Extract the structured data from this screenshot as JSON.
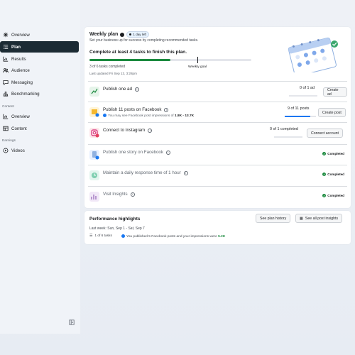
{
  "sidebar": {
    "items": [
      {
        "label": "Overview",
        "icon": "overview-icon"
      },
      {
        "label": "Plan",
        "icon": "plan-icon",
        "active": true
      },
      {
        "label": "Results",
        "icon": "results-icon"
      },
      {
        "label": "Audience",
        "icon": "audience-icon"
      },
      {
        "label": "Messaging",
        "icon": "messaging-icon"
      },
      {
        "label": "Benchmarking",
        "icon": "benchmarking-icon"
      }
    ],
    "content_section": "Content",
    "content_items": [
      {
        "label": "Overview",
        "icon": "content-overview-icon"
      },
      {
        "label": "Content",
        "icon": "content-icon"
      }
    ],
    "earnings_section": "Earnings",
    "earnings_items": [
      {
        "label": "Videos",
        "icon": "videos-icon"
      }
    ]
  },
  "weekly_plan": {
    "title": "Weekly plan",
    "badge": "1 day left",
    "subtitle": "Set your business up for success by completing recommended tasks.",
    "goal": "Complete at least 4 tasks to finish this plan.",
    "progress_fraction": 0.5,
    "goal_marker_label": "Weekly goal",
    "tasks_completed": "3 of 6 tasks completed",
    "last_updated": "Last updated Fri Sep 13, 3:28pm"
  },
  "tasks": [
    {
      "title": "Publish one ad",
      "progress": "0 of 1 ad",
      "progress_fraction": 0,
      "button": "Create ad",
      "muted": false
    },
    {
      "title": "Publish 11 posts on Facebook",
      "subtitle_prefix": "You may see Facebook post impressions of ",
      "subtitle_value": "1.8K - 13.7K",
      "progress": "9 of 11 posts",
      "progress_fraction": 0.82,
      "button": "Create post",
      "muted": false
    },
    {
      "title": "Connect to Instagram",
      "progress": "0 of 1 completed",
      "progress_fraction": 0,
      "button": "Connect account",
      "muted": false
    },
    {
      "title": "Publish one story on Facebook",
      "status": "Completed",
      "muted": true
    },
    {
      "title": "Maintain a daily response time of 1 hour",
      "status": "Completed",
      "muted": true
    },
    {
      "title": "Visit Insights",
      "status": "Completed",
      "muted": true
    }
  ],
  "performance": {
    "title": "Performance highlights",
    "btn_history": "See plan history",
    "btn_insights": "See all post insights",
    "week": "Last week: Sun, Sep 1 - Sat, Sep 7",
    "tasks": "1 of 6 tasks",
    "impressions_prefix": "You published 5 Facebook posts and your impressions were ",
    "impressions_value": "5.2K"
  },
  "colors": {
    "accent_green": "#1b8a3e",
    "accent_blue": "#1877f2",
    "sidebar_active": "#1c2b33"
  }
}
